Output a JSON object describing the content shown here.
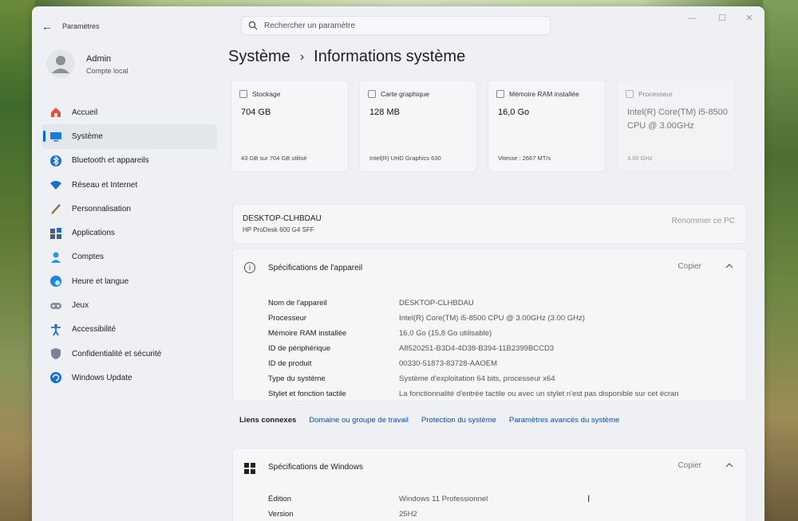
{
  "window": {
    "app_title": "Paramètres"
  },
  "search": {
    "placeholder": "Rechercher un paramètre"
  },
  "user": {
    "name": "Admin",
    "account_type": "Compte local"
  },
  "sidebar": {
    "items": [
      {
        "label": "Accueil",
        "icon": "home-icon"
      },
      {
        "label": "Système",
        "icon": "system-icon"
      },
      {
        "label": "Bluetooth et appareils",
        "icon": "bluetooth-icon"
      },
      {
        "label": "Réseau et Internet",
        "icon": "wifi-icon"
      },
      {
        "label": "Personnalisation",
        "icon": "brush-icon"
      },
      {
        "label": "Applications",
        "icon": "apps-icon"
      },
      {
        "label": "Comptes",
        "icon": "person-icon"
      },
      {
        "label": "Heure et langue",
        "icon": "globe-icon"
      },
      {
        "label": "Jeux",
        "icon": "gamepad-icon"
      },
      {
        "label": "Accessibilité",
        "icon": "accessibility-icon"
      },
      {
        "label": "Confidentialité et sécurité",
        "icon": "shield-icon"
      },
      {
        "label": "Windows Update",
        "icon": "update-icon"
      }
    ],
    "active_index": 1
  },
  "breadcrumb": {
    "parent": "Système",
    "separator": "›",
    "current": "Informations système"
  },
  "cards": [
    {
      "title": "Stockage",
      "value": "704 GB",
      "sub": "43 GB sur 704 GB utilisé"
    },
    {
      "title": "Carte graphique",
      "value": "128 MB",
      "sub": "Intel(R) UHD Graphics 630"
    },
    {
      "title": "Mémoire RAM installée",
      "value": "16,0 Go",
      "sub": "Vitesse : 2667 MT/s"
    },
    {
      "title": "Processeur",
      "value": "Intel(R) Core(TM) i5-8500 CPU @ 3.00GHz",
      "sub": "3.00 GHz"
    }
  ],
  "device": {
    "name": "DESKTOP-CLHBDAU",
    "model": "HP ProDesk 600 G4 SFF",
    "rename_label": "Renommer ce PC"
  },
  "device_specs": {
    "title": "Spécifications de l'appareil",
    "copy_label": "Copier",
    "rows": [
      {
        "label": "Nom de l'appareil",
        "value": "DESKTOP-CLHBDAU"
      },
      {
        "label": "Processeur",
        "value": "Intel(R) Core(TM) i5-8500 CPU @ 3.00GHz (3.00 GHz)"
      },
      {
        "label": "Mémoire RAM installée",
        "value": "16,0 Go (15,8 Go utilisable)"
      },
      {
        "label": "ID de périphérique",
        "value": "A8520251-B3D4-4D38-B394-11B2399BCCD3"
      },
      {
        "label": "ID de produit",
        "value": "00330-51873-83728-AAOEM"
      },
      {
        "label": "Type du système",
        "value": "Système d'exploitation 64 bits, processeur x64"
      },
      {
        "label": "Stylet et fonction tactile",
        "value": "La fonctionnalité d'entrée tactile ou avec un stylet n'est pas disponible sur cet écran"
      }
    ]
  },
  "related_links": {
    "label": "Liens connexes",
    "links": [
      "Domaine ou groupe de travail",
      "Protection du système",
      "Paramètres avancés du système"
    ]
  },
  "windows_specs": {
    "title": "Spécifications de Windows",
    "copy_label": "Copier",
    "rows": [
      {
        "label": "Édition",
        "value": "Windows 11 Professionnel"
      },
      {
        "label": "Version",
        "value": "25H2"
      }
    ]
  },
  "colors": {
    "accent": "#0067c0",
    "link": "#0b4fa8",
    "window_bg": "#eef0f3",
    "card_bg": "#f5f6f8"
  }
}
